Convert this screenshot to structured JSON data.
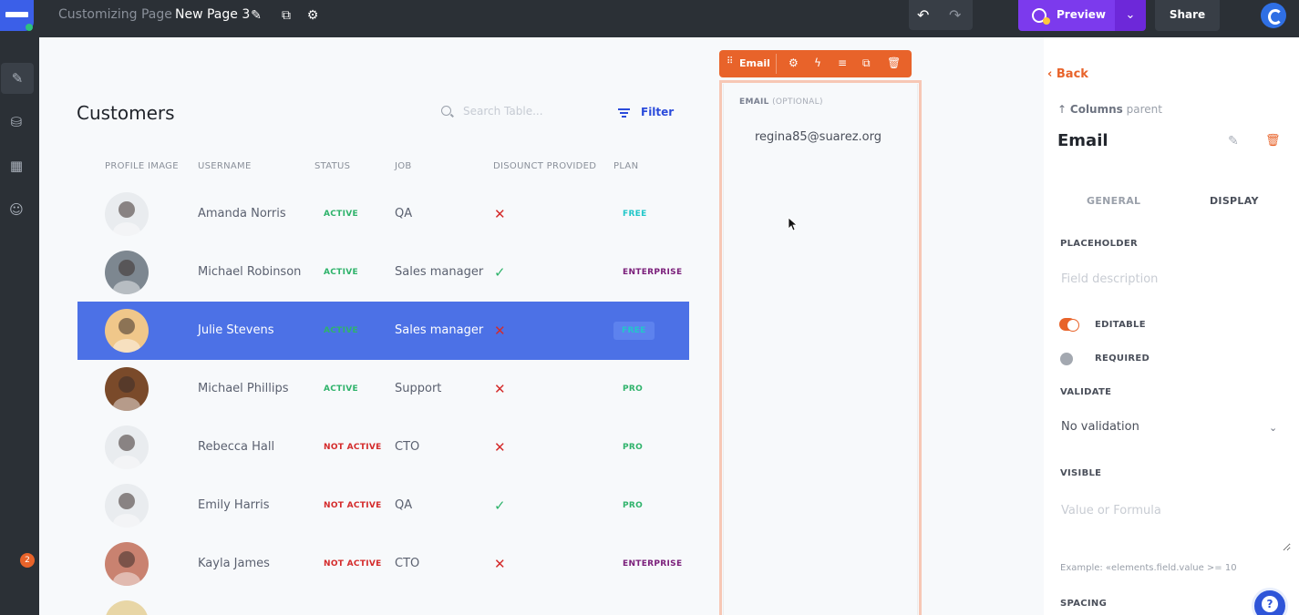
{
  "topbar": {
    "crumb_section": "Customizing Page",
    "page_name": "New Page 3",
    "preview_label": "Preview",
    "share_label": "Share",
    "colors": {
      "bg": "#2b3036",
      "preview": "#7c3aed",
      "accent": "#e8632a"
    }
  },
  "rail": {
    "items": [
      "design-icon",
      "database-icon",
      "layout-icon",
      "users-icon"
    ],
    "badge": "2"
  },
  "table": {
    "title": "Customers",
    "search_placeholder": "Search Table...",
    "filter_label": "Filter",
    "columns": [
      "PROFILE IMAGE",
      "USERNAME",
      "STATUS",
      "JOB",
      "DISOUNCT PROVIDED",
      "PLAN"
    ],
    "rows": [
      {
        "name": "Amanda Norris",
        "status": "ACTIVE",
        "job": "QA",
        "discount": "✕",
        "plan": "FREE"
      },
      {
        "name": "Michael Robinson",
        "status": "ACTIVE",
        "job": "Sales manager",
        "discount": "✓",
        "plan": "ENTERPRISE"
      },
      {
        "name": "Julie Stevens",
        "status": "ACTIVE",
        "job": "Sales manager",
        "discount": "✕",
        "plan": "FREE"
      },
      {
        "name": "Michael Phillips",
        "status": "ACTIVE",
        "job": "Support",
        "discount": "✕",
        "plan": "PRO"
      },
      {
        "name": "Rebecca Hall",
        "status": "NOT ACTIVE",
        "job": "CTO",
        "discount": "✕",
        "plan": "PRO"
      },
      {
        "name": "Emily Harris",
        "status": "NOT ACTIVE",
        "job": "QA",
        "discount": "✓",
        "plan": "PRO"
      },
      {
        "name": "Kayla James",
        "status": "NOT ACTIVE",
        "job": "CTO",
        "discount": "✕",
        "plan": "ENTERPRISE"
      }
    ],
    "selected_row": 2,
    "status_colors": {
      "ACTIVE": "#2fb36b",
      "NOT ACTIVE": "#d42b2b"
    },
    "plan_colors": {
      "FREE": "#22c7c9",
      "ENTERPRISE": "#7a1e7a",
      "PRO": "#2fb36b"
    }
  },
  "column_edit": {
    "toolbar_label": "Email",
    "header": "EMAIL",
    "header_optional": "(OPTIONAL)",
    "value": "regina85@suarez.org"
  },
  "panel": {
    "back_label": "Back",
    "parent_bold": "Columns",
    "parent_muted": "parent",
    "title": "Email",
    "tab_general": "GENERAL",
    "tab_display": "DISPLAY",
    "placeholder_label": "PLACEHOLDER",
    "placeholder_input": "Field description",
    "editable_label": "EDITABLE",
    "required_label": "REQUIRED",
    "validate_label": "VALIDATE",
    "validate_value": "No validation",
    "visible_label": "VISIBLE",
    "visible_placeholder": "Value or Formula",
    "hint": "Example: «elements.field.value >= 10",
    "spacing_label": "SPACING"
  }
}
